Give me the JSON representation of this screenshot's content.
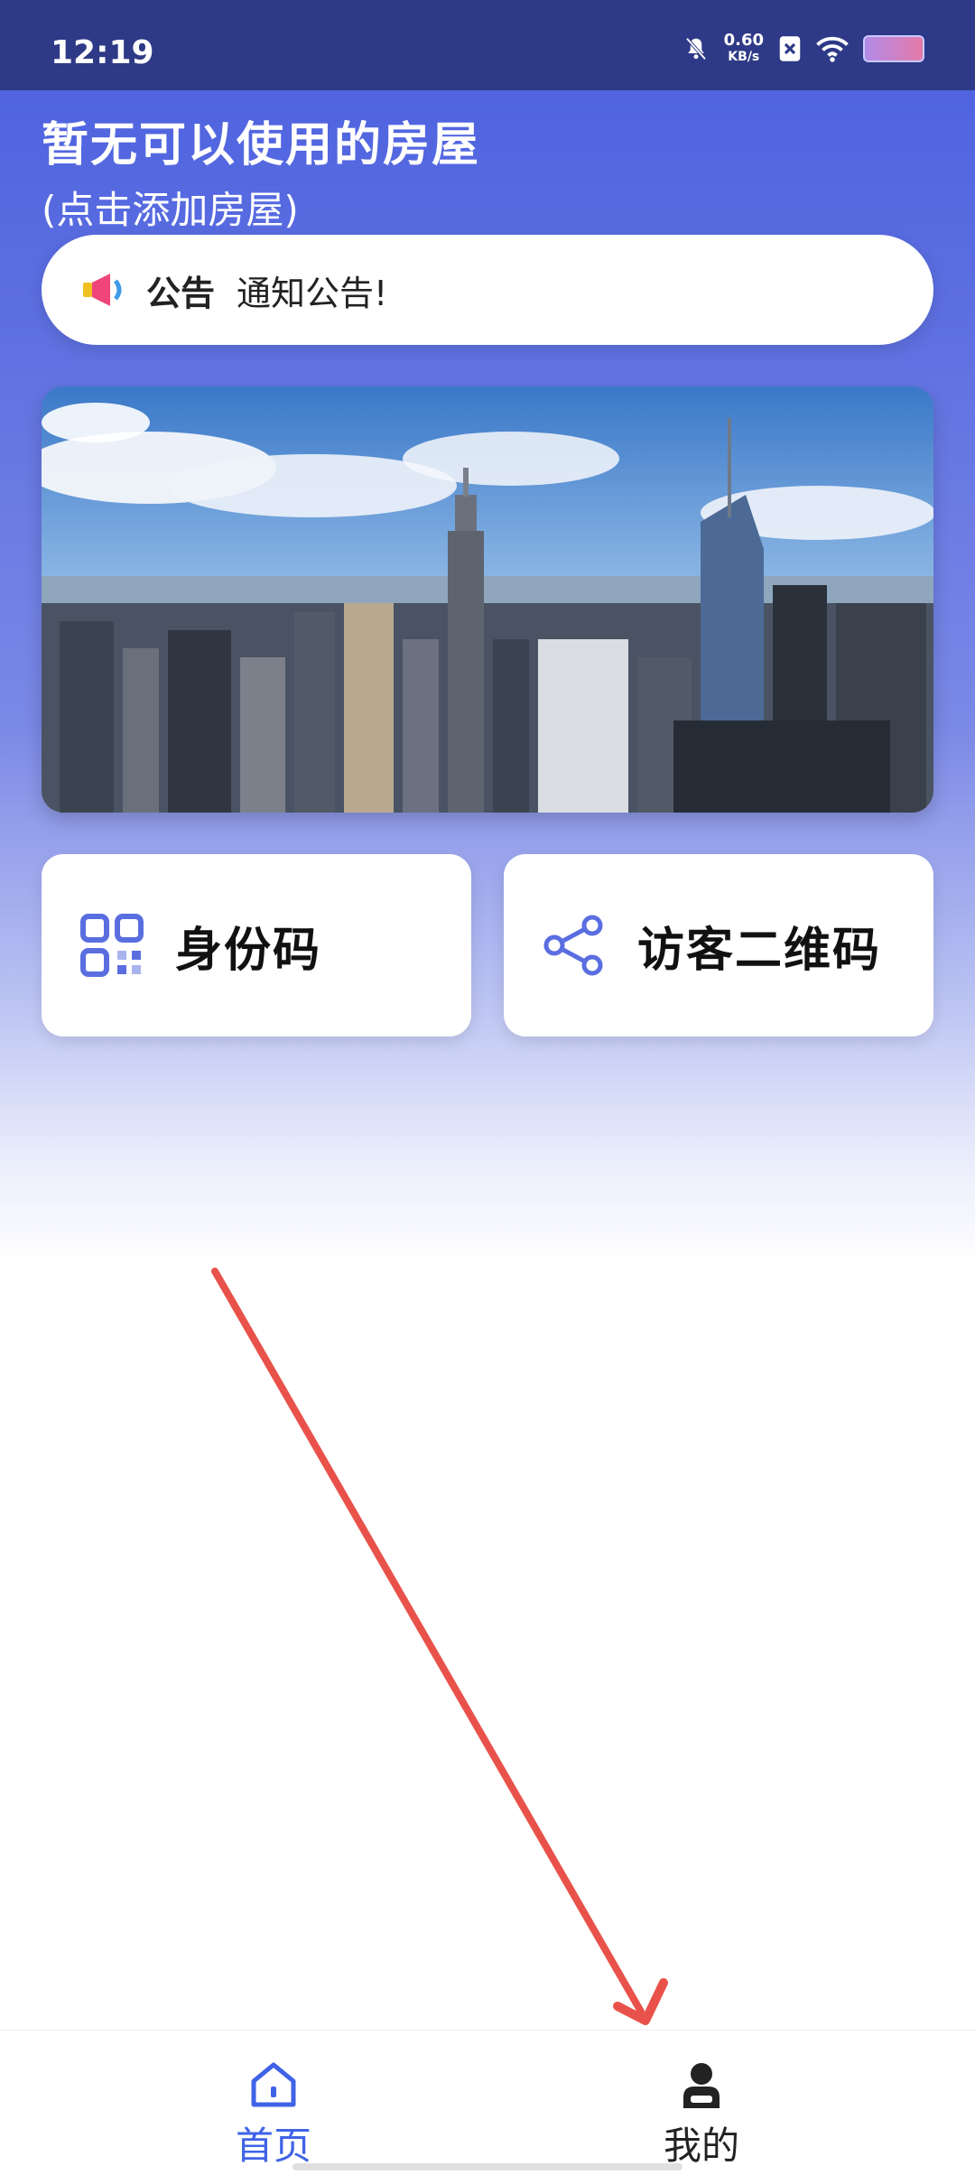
{
  "status_bar": {
    "time": "12:19",
    "net_speed_value": "0.60",
    "net_speed_unit": "KB/s",
    "icons": [
      "bell-off-icon",
      "sim-x-icon",
      "wifi-icon",
      "battery-icon"
    ]
  },
  "header": {
    "title": "暂无可以使用的房屋",
    "subtitle": "(点击添加房屋)"
  },
  "notice": {
    "label": "公告",
    "text": "通知公告!",
    "icon": "megaphone-icon"
  },
  "banner": {
    "image": "city-skyline-photo"
  },
  "tiles": [
    {
      "label": "身份码",
      "icon": "qr-code-icon"
    },
    {
      "label": "访客二维码",
      "icon": "share-icon"
    }
  ],
  "tabbar": {
    "items": [
      {
        "label": "首页",
        "icon": "home-icon",
        "active": true
      },
      {
        "label": "我的",
        "icon": "user-icon",
        "active": false
      }
    ]
  },
  "colors": {
    "accent": "#3f63e6",
    "header_bg": "#2e3a87",
    "annotation_arrow": "#e8524a"
  }
}
